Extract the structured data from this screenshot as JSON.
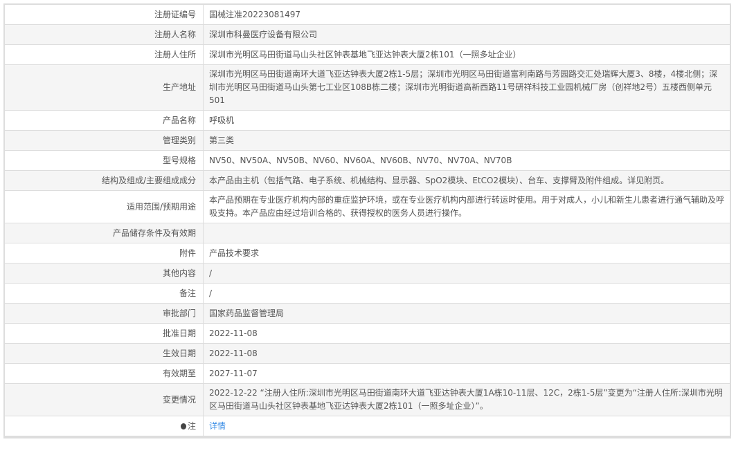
{
  "rows": [
    {
      "label": "注册证编号",
      "value": "国械注准20223081497"
    },
    {
      "label": "注册人名称",
      "value": "深圳市科曼医疗设备有限公司"
    },
    {
      "label": "注册人住所",
      "value": "深圳市光明区马田街道马山头社区钟表基地飞亚达钟表大厦2栋101（一照多址企业）"
    },
    {
      "label": "生产地址",
      "value": "深圳市光明区马田街道南环大道飞亚达钟表大厦2栋1-5层；深圳市光明区马田街道富利南路与芳园路交汇处瑞辉大厦3、8楼，4楼北侧；深圳市光明区马田街道马山头第七工业区108B栋二楼；深圳市光明街道高新西路11号研祥科技工业园机械厂房（创祥地2号）五楼西侧单元501"
    },
    {
      "label": "产品名称",
      "value": "呼吸机"
    },
    {
      "label": "管理类别",
      "value": "第三类"
    },
    {
      "label": "型号规格",
      "value": "NV50、NV50A、NV50B、NV60、NV60A、NV60B、NV70、NV70A、NV70B"
    },
    {
      "label": "结构及组成/主要组成成分",
      "value": "本产品由主机（包括气路、电子系统、机械结构、显示器、SpO2模块、EtCO2模块）、台车、支撑臂及附件组成。详见附页。"
    },
    {
      "label": "适用范围/预期用途",
      "value": "本产品预期在专业医疗机构内部的重症监护环境，或在专业医疗机构内部进行转运时使用。用于对成人，小儿和新生儿患者进行通气辅助及呼吸支持。本产品应由经过培训合格的、获得授权的医务人员进行操作。"
    },
    {
      "label": "产品储存条件及有效期",
      "value": ""
    },
    {
      "label": "附件",
      "value": "产品技术要求"
    },
    {
      "label": "其他内容",
      "value": "/"
    },
    {
      "label": "备注",
      "value": "/"
    },
    {
      "label": "审批部门",
      "value": "国家药品监督管理局"
    },
    {
      "label": "批准日期",
      "value": "2022-11-08"
    },
    {
      "label": "生效日期",
      "value": "2022-11-08"
    },
    {
      "label": "有效期至",
      "value": "2027-11-07"
    },
    {
      "label": "变更情况",
      "value": "2022-12-22 “注册人住所:深圳市光明区马田街道南环大道飞亚达钟表大厦1A栋10-11层、12C，2栋1-5层”变更为“注册人住所:深圳市光明区马田街道马山头社区钟表基地飞亚达钟表大厦2栋101（一照多址企业）”。"
    }
  ],
  "note": {
    "label": "注",
    "link": "详情"
  }
}
